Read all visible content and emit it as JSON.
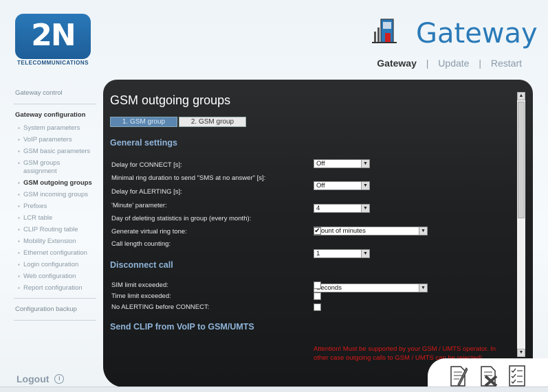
{
  "header": {
    "logo_text": "2N",
    "logo_sub": "TELECOMMUNICATIONS",
    "brand_title": "Gateway",
    "nav": [
      {
        "label": "Gateway",
        "active": true
      },
      {
        "label": "Update",
        "active": false
      },
      {
        "label": "Restart",
        "active": false
      }
    ],
    "nav_separator": "|"
  },
  "sidebar": {
    "gateway_control": "Gateway control",
    "gateway_configuration": "Gateway configuration",
    "items": [
      {
        "label": "System parameters"
      },
      {
        "label": "VoIP parameters"
      },
      {
        "label": "GSM basic parameters"
      },
      {
        "label": "GSM groups assignment"
      },
      {
        "label": "GSM outgoing groups",
        "current": true
      },
      {
        "label": "GSM incoming groups"
      },
      {
        "label": "Prefixes"
      },
      {
        "label": "LCR table"
      },
      {
        "label": "CLIP Routing table"
      },
      {
        "label": "Mobility Extension"
      },
      {
        "label": "Ethernet configuration"
      },
      {
        "label": "Login configuration"
      },
      {
        "label": "Web configuration"
      },
      {
        "label": "Report configuration"
      }
    ],
    "configuration_backup": "Configuration backup",
    "logout": "Logout"
  },
  "main": {
    "title": "GSM outgoing groups",
    "tabs": [
      {
        "label": "1. GSM group",
        "active": true
      },
      {
        "label": "2. GSM group",
        "active": false
      }
    ],
    "sections": {
      "general": "General settings",
      "disconnect": "Disconnect call",
      "send_clip": "Send CLIP from VoIP to GSM/UMTS"
    },
    "general_rows": [
      {
        "label": "Delay for CONNECT [s]:",
        "value": "Off"
      },
      {
        "label": "Minimal ring duration to send \"SMS at no answer\" [s]:",
        "value": "Off"
      },
      {
        "label": "Delay for ALERTING [s]:",
        "value": "4"
      },
      {
        "label": "'Minute' parameter:",
        "value": "Count of minutes"
      },
      {
        "label": "Day of deleting statistics in group (every month):",
        "value": "1"
      },
      {
        "label": "Generate virtual ring tone:",
        "checked": true
      },
      {
        "label": "Call length counting:",
        "value": "Seconds"
      }
    ],
    "disconnect_rows": [
      {
        "label": "SIM limit exceeded:",
        "checked": false
      },
      {
        "label": "Time limit exceeded:",
        "checked": false
      },
      {
        "label": "No ALERTING before CONNECT:",
        "checked": false
      }
    ],
    "warning_line1": "Attention! Must be supported by your GSM / UMTS operator. In",
    "warning_line2": "other case outgoing calls to GSM / UMTS can be rejected!"
  },
  "colors": {
    "accent": "#2a7ab8",
    "section": "#8fb4d8",
    "warning": "#d81818"
  }
}
